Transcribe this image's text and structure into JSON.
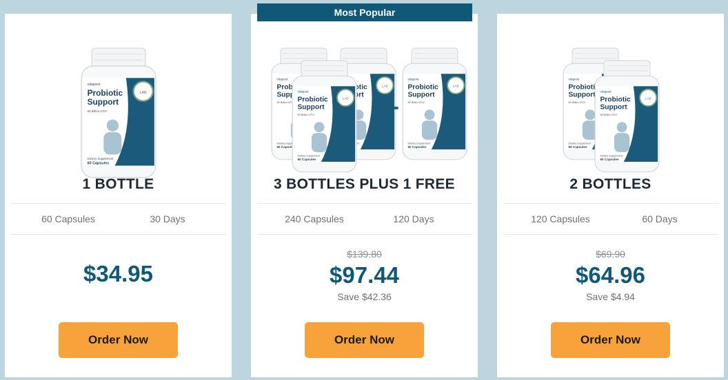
{
  "ribbon": {
    "label": "Most Popular"
  },
  "bottle": {
    "brand": "vitapost",
    "name_line1": "Probiotic",
    "name_line2": "Support",
    "cfu": "50 Billion CFU*",
    "seal": "LABORATORY",
    "footer_line1": "Dietary Supplement",
    "footer_line2": "60 Capsules"
  },
  "colors": {
    "accent": "#0f5878",
    "button": "#f7a23b",
    "background": "#bcd5de"
  },
  "plans": [
    {
      "title": "1 BOTTLE",
      "capsules": "60 Capsules",
      "days": "30 Days",
      "old_price": "",
      "price": "$34.95",
      "save": "",
      "button_label": "Order Now"
    },
    {
      "title": "3 BOTTLES PLUS 1 FREE",
      "capsules": "240 Capsules",
      "days": "120 Days",
      "old_price": "$139.80",
      "price": "$97.44",
      "save": "Save $42.36",
      "button_label": "Order Now"
    },
    {
      "title": "2 BOTTLES",
      "capsules": "120 Capsules",
      "days": "60 Days",
      "old_price": "$69.90",
      "price": "$64.96",
      "save": "Save $4.94",
      "button_label": "Order Now"
    }
  ]
}
